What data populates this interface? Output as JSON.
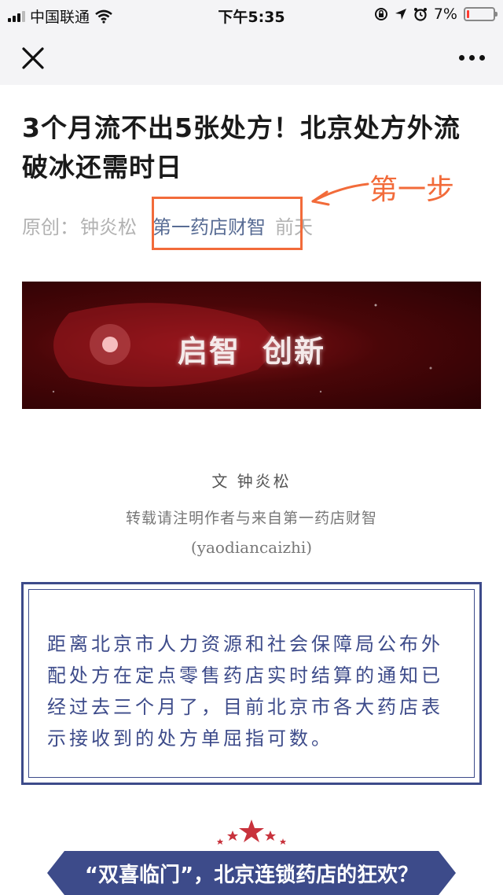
{
  "status_bar": {
    "carrier": "中国联通",
    "time": "下午5:35",
    "battery": "7%",
    "battery_level": 0.07
  },
  "nav": {
    "close_icon": "close-icon",
    "more_icon": "more-dots-icon"
  },
  "article": {
    "title": "3个月流不出5张处方！北京处方外流破冰还需时日",
    "original_label": "原创：",
    "author": "钟炎松",
    "account": "第一药店财智",
    "date": "前天"
  },
  "annotation": {
    "label": "第一步",
    "color": "#f26b3a"
  },
  "banner": {
    "left": "启智",
    "right": "创新"
  },
  "credits": {
    "byline": "文 钟炎松",
    "reprint": "转载请注明作者与来自第一药店财智",
    "handle": "(yaodiancaizhi)"
  },
  "quote": {
    "text": "距离北京市人力资源和社会保障局公布外配处方在定点零售药店实时结算的通知已经过去三个月了，目前北京市各大药店表示接收到的处方单屈指可数。",
    "color": "#3d4b8a"
  },
  "section": {
    "title": "“双喜临门”，北京连锁药店的狂欢？",
    "band_color": "#3d4b8a",
    "star_color": "#c8323c"
  }
}
